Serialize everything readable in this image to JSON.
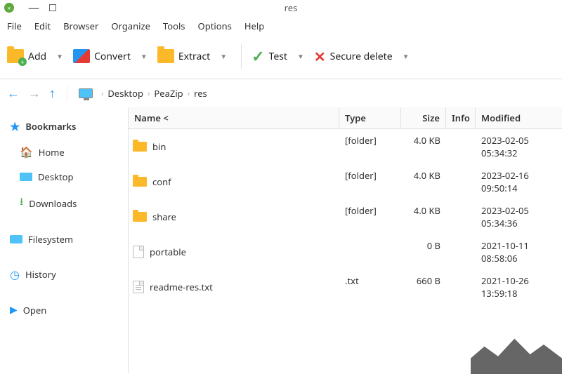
{
  "window": {
    "title": "res"
  },
  "menu": {
    "file": "File",
    "edit": "Edit",
    "browser": "Browser",
    "organize": "Organize",
    "tools": "Tools",
    "options": "Options",
    "help": "Help"
  },
  "toolbar": {
    "add": "Add",
    "convert": "Convert",
    "extract": "Extract",
    "test": "Test",
    "secure_delete": "Secure delete"
  },
  "breadcrumbs": {
    "a": "Desktop",
    "b": "PeaZip",
    "c": "res"
  },
  "sidebar": {
    "bookmarks": "Bookmarks",
    "home": "Home",
    "desktop": "Desktop",
    "downloads": "Downloads",
    "filesystem": "Filesystem",
    "history": "History",
    "open": "Open"
  },
  "columns": {
    "name": "Name <",
    "type": "Type",
    "size": "Size",
    "info": "Info",
    "modified": "Modified"
  },
  "rows": [
    {
      "name": "bin",
      "kind": "folder",
      "type": "[folder]",
      "size": "4.0 KB",
      "info": "",
      "modified": "2023-02-05 05:34:32"
    },
    {
      "name": "conf",
      "kind": "folder",
      "type": "[folder]",
      "size": "4.0 KB",
      "info": "",
      "modified": "2023-02-16 09:50:14"
    },
    {
      "name": "share",
      "kind": "folder",
      "type": "[folder]",
      "size": "4.0 KB",
      "info": "",
      "modified": "2023-02-05 05:34:36"
    },
    {
      "name": "portable",
      "kind": "file",
      "type": "",
      "size": "0 B",
      "info": "",
      "modified": "2021-10-11 08:58:06"
    },
    {
      "name": "readme-res.txt",
      "kind": "txt",
      "type": ".txt",
      "size": "660 B",
      "info": "",
      "modified": "2021-10-26 13:59:18"
    }
  ]
}
